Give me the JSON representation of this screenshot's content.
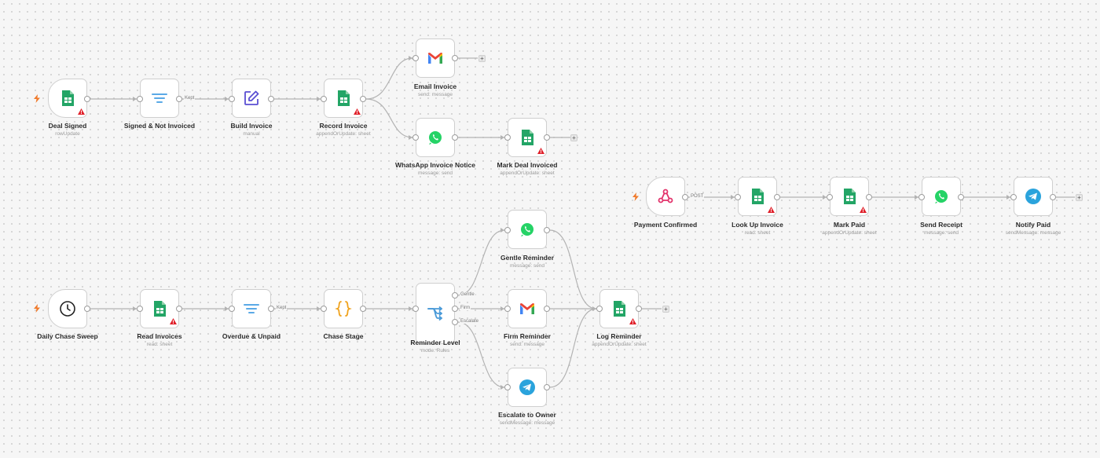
{
  "workflows": {
    "invoice": {
      "deal_signed": {
        "label": "Deal Signed",
        "sub": "rowUpdate"
      },
      "signed_not_invoiced": {
        "label": "Signed & Not Invoiced",
        "edge": "Kept"
      },
      "build_invoice": {
        "label": "Build Invoice",
        "sub": "manual"
      },
      "record_invoice": {
        "label": "Record Invoice",
        "sub": "appendOrUpdate: sheet"
      },
      "email_invoice": {
        "label": "Email Invoice",
        "sub": "send: message"
      },
      "whatsapp_invoice_notice": {
        "label": "WhatsApp Invoice Notice",
        "sub": "message: send"
      },
      "mark_deal_invoiced": {
        "label": "Mark Deal Invoiced",
        "sub": "appendOrUpdate: sheet"
      }
    },
    "payment": {
      "payment_confirmed": {
        "label": "Payment Confirmed",
        "edge": "POST"
      },
      "look_up_invoice": {
        "label": "Look Up Invoice",
        "sub": "read: sheet"
      },
      "mark_paid": {
        "label": "Mark Paid",
        "sub": "appendOrUpdate: sheet"
      },
      "send_receipt": {
        "label": "Send Receipt",
        "sub": "message: send"
      },
      "notify_paid": {
        "label": "Notify Paid",
        "sub": "sendMessage: message"
      }
    },
    "chase": {
      "daily_chase_sweep": {
        "label": "Daily Chase Sweep"
      },
      "read_invoices": {
        "label": "Read Invoices",
        "sub": "read: sheet"
      },
      "overdue_unpaid": {
        "label": "Overdue & Unpaid",
        "edge": "Kept"
      },
      "chase_stage": {
        "label": "Chase Stage"
      },
      "reminder_level": {
        "label": "Reminder Level",
        "sub": "mode: Rules",
        "outputs": [
          "Gentle",
          "Firm",
          "Escalate"
        ]
      },
      "gentle_reminder": {
        "label": "Gentle Reminder",
        "sub": "message: send"
      },
      "firm_reminder": {
        "label": "Firm Reminder",
        "sub": "send: message"
      },
      "escalate_to_owner": {
        "label": "Escalate to Owner",
        "sub": "sendMessage: message"
      },
      "log_reminder": {
        "label": "Log Reminder",
        "sub": "appendOrUpdate: sheet"
      }
    }
  },
  "colors": {
    "sheets_green": "#23a566",
    "filter_blue": "#5aa9e6",
    "edit_purple": "#5a4fd3",
    "code_orange": "#f0a31e",
    "switch_blue": "#4a9ad8",
    "whatsapp_green": "#25d366",
    "telegram_blue": "#2aa3dc",
    "webhook_pink": "#e2336b",
    "trigger_orange": "#f07a2b",
    "warning_red": "#e0202a",
    "wire_gray": "#b3b3b3"
  },
  "icons": [
    "google-sheets-icon",
    "filter-icon",
    "edit-icon",
    "gmail-icon",
    "whatsapp-icon",
    "webhook-icon",
    "telegram-icon",
    "clock-icon",
    "code-braces-icon",
    "switch-icon",
    "warning-icon",
    "lightning-icon",
    "plus-icon"
  ]
}
